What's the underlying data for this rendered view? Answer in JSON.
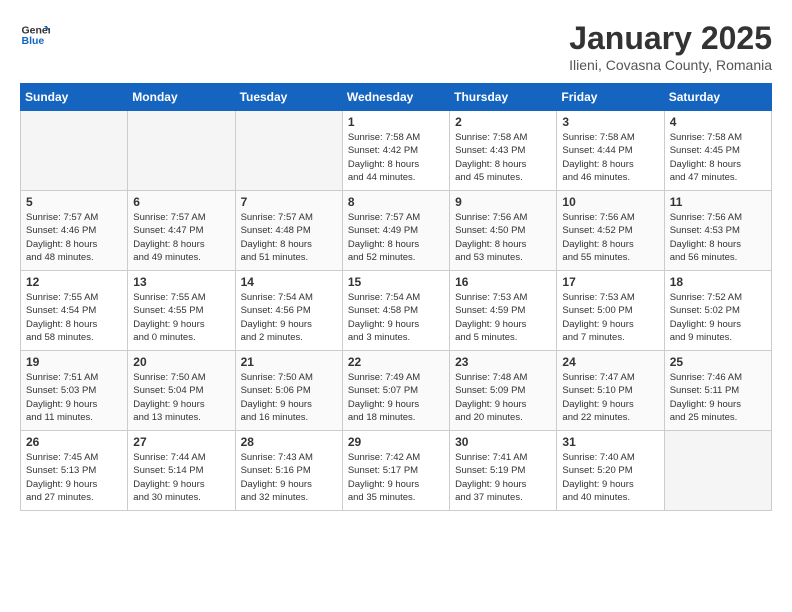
{
  "header": {
    "logo_line1": "General",
    "logo_line2": "Blue",
    "title": "January 2025",
    "subtitle": "Ilieni, Covasna County, Romania"
  },
  "weekdays": [
    "Sunday",
    "Monday",
    "Tuesday",
    "Wednesday",
    "Thursday",
    "Friday",
    "Saturday"
  ],
  "weeks": [
    [
      {
        "day": "",
        "info": ""
      },
      {
        "day": "",
        "info": ""
      },
      {
        "day": "",
        "info": ""
      },
      {
        "day": "1",
        "info": "Sunrise: 7:58 AM\nSunset: 4:42 PM\nDaylight: 8 hours\nand 44 minutes."
      },
      {
        "day": "2",
        "info": "Sunrise: 7:58 AM\nSunset: 4:43 PM\nDaylight: 8 hours\nand 45 minutes."
      },
      {
        "day": "3",
        "info": "Sunrise: 7:58 AM\nSunset: 4:44 PM\nDaylight: 8 hours\nand 46 minutes."
      },
      {
        "day": "4",
        "info": "Sunrise: 7:58 AM\nSunset: 4:45 PM\nDaylight: 8 hours\nand 47 minutes."
      }
    ],
    [
      {
        "day": "5",
        "info": "Sunrise: 7:57 AM\nSunset: 4:46 PM\nDaylight: 8 hours\nand 48 minutes."
      },
      {
        "day": "6",
        "info": "Sunrise: 7:57 AM\nSunset: 4:47 PM\nDaylight: 8 hours\nand 49 minutes."
      },
      {
        "day": "7",
        "info": "Sunrise: 7:57 AM\nSunset: 4:48 PM\nDaylight: 8 hours\nand 51 minutes."
      },
      {
        "day": "8",
        "info": "Sunrise: 7:57 AM\nSunset: 4:49 PM\nDaylight: 8 hours\nand 52 minutes."
      },
      {
        "day": "9",
        "info": "Sunrise: 7:56 AM\nSunset: 4:50 PM\nDaylight: 8 hours\nand 53 minutes."
      },
      {
        "day": "10",
        "info": "Sunrise: 7:56 AM\nSunset: 4:52 PM\nDaylight: 8 hours\nand 55 minutes."
      },
      {
        "day": "11",
        "info": "Sunrise: 7:56 AM\nSunset: 4:53 PM\nDaylight: 8 hours\nand 56 minutes."
      }
    ],
    [
      {
        "day": "12",
        "info": "Sunrise: 7:55 AM\nSunset: 4:54 PM\nDaylight: 8 hours\nand 58 minutes."
      },
      {
        "day": "13",
        "info": "Sunrise: 7:55 AM\nSunset: 4:55 PM\nDaylight: 9 hours\nand 0 minutes."
      },
      {
        "day": "14",
        "info": "Sunrise: 7:54 AM\nSunset: 4:56 PM\nDaylight: 9 hours\nand 2 minutes."
      },
      {
        "day": "15",
        "info": "Sunrise: 7:54 AM\nSunset: 4:58 PM\nDaylight: 9 hours\nand 3 minutes."
      },
      {
        "day": "16",
        "info": "Sunrise: 7:53 AM\nSunset: 4:59 PM\nDaylight: 9 hours\nand 5 minutes."
      },
      {
        "day": "17",
        "info": "Sunrise: 7:53 AM\nSunset: 5:00 PM\nDaylight: 9 hours\nand 7 minutes."
      },
      {
        "day": "18",
        "info": "Sunrise: 7:52 AM\nSunset: 5:02 PM\nDaylight: 9 hours\nand 9 minutes."
      }
    ],
    [
      {
        "day": "19",
        "info": "Sunrise: 7:51 AM\nSunset: 5:03 PM\nDaylight: 9 hours\nand 11 minutes."
      },
      {
        "day": "20",
        "info": "Sunrise: 7:50 AM\nSunset: 5:04 PM\nDaylight: 9 hours\nand 13 minutes."
      },
      {
        "day": "21",
        "info": "Sunrise: 7:50 AM\nSunset: 5:06 PM\nDaylight: 9 hours\nand 16 minutes."
      },
      {
        "day": "22",
        "info": "Sunrise: 7:49 AM\nSunset: 5:07 PM\nDaylight: 9 hours\nand 18 minutes."
      },
      {
        "day": "23",
        "info": "Sunrise: 7:48 AM\nSunset: 5:09 PM\nDaylight: 9 hours\nand 20 minutes."
      },
      {
        "day": "24",
        "info": "Sunrise: 7:47 AM\nSunset: 5:10 PM\nDaylight: 9 hours\nand 22 minutes."
      },
      {
        "day": "25",
        "info": "Sunrise: 7:46 AM\nSunset: 5:11 PM\nDaylight: 9 hours\nand 25 minutes."
      }
    ],
    [
      {
        "day": "26",
        "info": "Sunrise: 7:45 AM\nSunset: 5:13 PM\nDaylight: 9 hours\nand 27 minutes."
      },
      {
        "day": "27",
        "info": "Sunrise: 7:44 AM\nSunset: 5:14 PM\nDaylight: 9 hours\nand 30 minutes."
      },
      {
        "day": "28",
        "info": "Sunrise: 7:43 AM\nSunset: 5:16 PM\nDaylight: 9 hours\nand 32 minutes."
      },
      {
        "day": "29",
        "info": "Sunrise: 7:42 AM\nSunset: 5:17 PM\nDaylight: 9 hours\nand 35 minutes."
      },
      {
        "day": "30",
        "info": "Sunrise: 7:41 AM\nSunset: 5:19 PM\nDaylight: 9 hours\nand 37 minutes."
      },
      {
        "day": "31",
        "info": "Sunrise: 7:40 AM\nSunset: 5:20 PM\nDaylight: 9 hours\nand 40 minutes."
      },
      {
        "day": "",
        "info": ""
      }
    ]
  ]
}
